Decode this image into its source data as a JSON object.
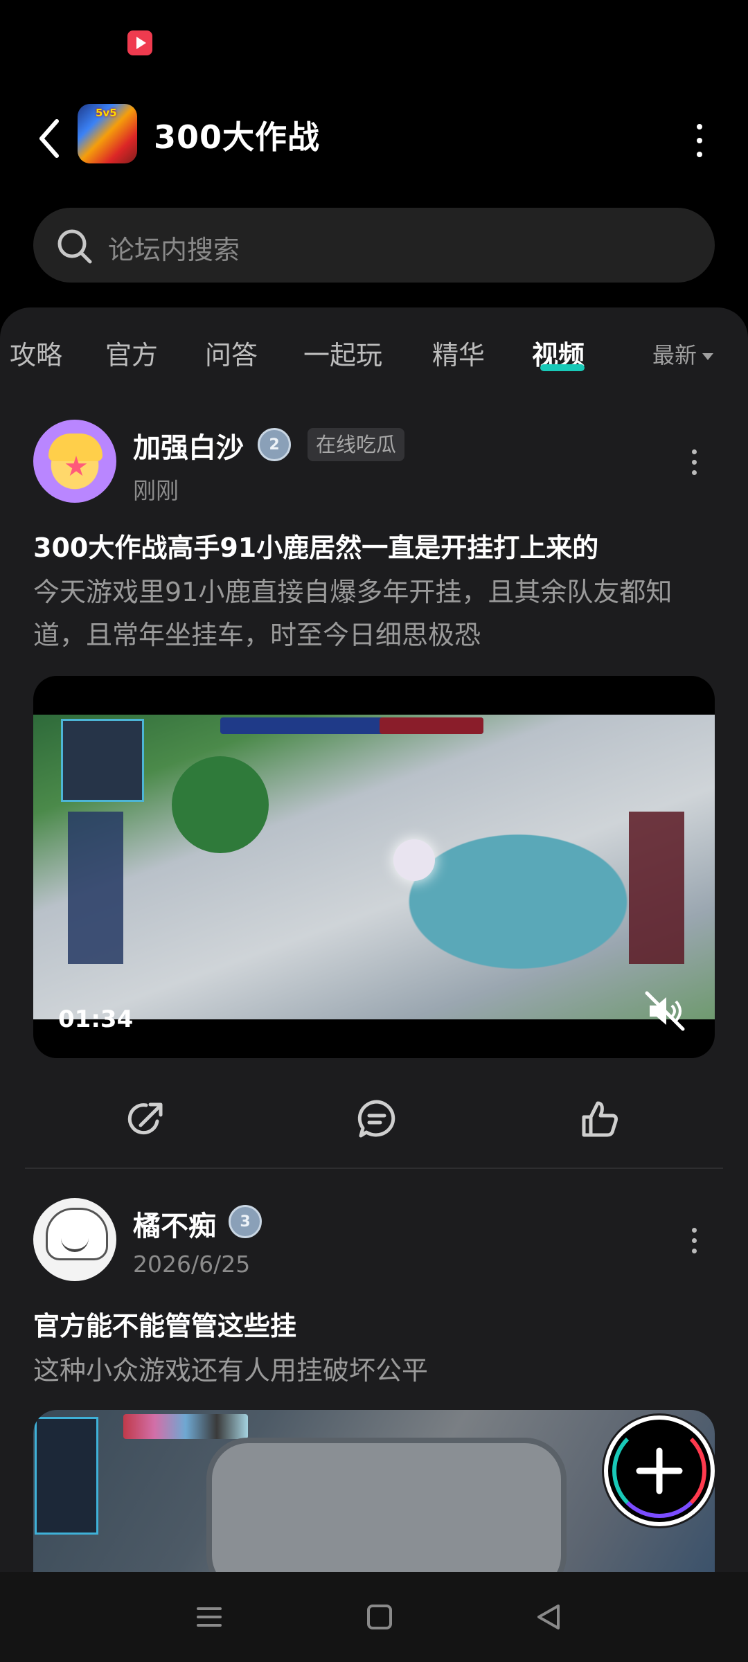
{
  "header": {
    "title": "300大作战",
    "avatar_badge": "5v5"
  },
  "search": {
    "placeholder": "论坛内搜索"
  },
  "tabs": [
    {
      "label": "攻略"
    },
    {
      "label": "官方"
    },
    {
      "label": "问答"
    },
    {
      "label": "一起玩"
    },
    {
      "label": "精华"
    },
    {
      "label": "视频",
      "active": true
    }
  ],
  "sort": {
    "label": "最新"
  },
  "posts": [
    {
      "username": "加强白沙",
      "level": "2",
      "tag": "在线吃瓜",
      "time": "刚刚",
      "title": "300大作战高手91小鹿居然一直是开挂打上来的",
      "body": "今天游戏里91小鹿直接自爆多年开挂，且其余队友都知道，且常年坐挂车，时至今日细思极恐",
      "video_duration": "01:34"
    },
    {
      "username": "橘不痴",
      "level": "3",
      "time": "2026/6/25",
      "title": "官方能不能管管这些挂",
      "body": "这种小众游戏还有人用挂破坏公平"
    }
  ],
  "colors": {
    "accent": "#19c9b8",
    "panel": "#1c1c1e",
    "background": "#000000"
  }
}
